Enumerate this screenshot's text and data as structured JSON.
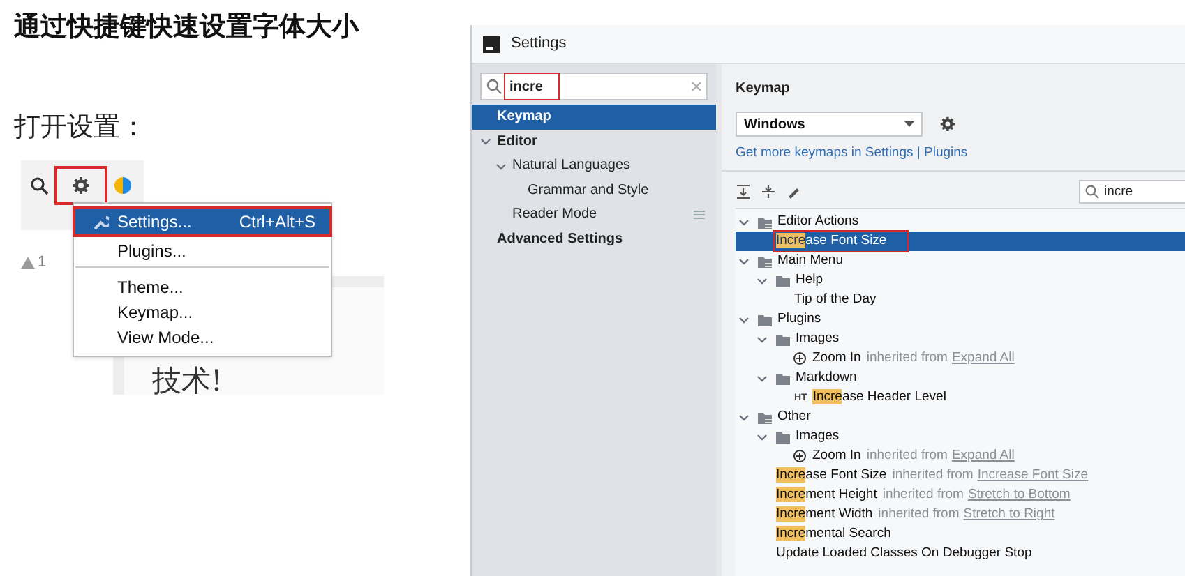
{
  "heading": "通过快捷键快速设置字体大小",
  "step": "打开设置：",
  "ide_snippet": {
    "warning_count": "1",
    "document_text": "技术!",
    "menu": [
      {
        "label": "Settings...",
        "shortcut": "Ctrl+Alt+S",
        "selected": true,
        "outlined": true,
        "divider_after": false
      },
      {
        "label": "Plugins...",
        "selected": false,
        "outlined": false,
        "divider_after": true
      },
      {
        "label": "Theme...",
        "selected": false,
        "outlined": false,
        "divider_after": false
      },
      {
        "label": "Keymap...",
        "selected": false,
        "outlined": false,
        "divider_after": false
      },
      {
        "label": "View Mode...",
        "selected": false,
        "outlined": false,
        "divider_after": false
      }
    ]
  },
  "settings": {
    "title": "Settings",
    "search": {
      "value": "incre",
      "outlined": true
    },
    "sidebar": [
      {
        "label": "Keymap",
        "bold": true,
        "selected": true
      },
      {
        "label": "Editor",
        "bold": true,
        "selected": false,
        "expanded": true,
        "children": [
          {
            "label": "Natural Languages",
            "bold": false,
            "selected": false,
            "expanded": true,
            "children": [
              {
                "label": "Grammar and Style",
                "bold": false,
                "selected": false
              }
            ]
          },
          {
            "label": "Reader Mode",
            "bold": false,
            "selected": false,
            "has_badge": true
          }
        ]
      },
      {
        "label": "Advanced Settings",
        "bold": true,
        "selected": false
      }
    ],
    "keymap": {
      "heading": "Keymap",
      "scheme": "Windows",
      "link": "Get more keymaps in Settings | Plugins",
      "filter": "incre",
      "tree": [
        {
          "kind": "group",
          "label": "Editor Actions",
          "expanded": true,
          "children": [
            {
              "kind": "action",
              "match": "Incre",
              "rest": "ase Font Size",
              "selected": true,
              "outlined": true
            }
          ]
        },
        {
          "kind": "group",
          "label": "Main Menu",
          "expanded": true,
          "children": [
            {
              "kind": "folder",
              "label": "Help",
              "expanded": true,
              "children": [
                {
                  "kind": "action",
                  "rest": "Tip of the Day",
                  "selected": false,
                  "outlined": false
                }
              ]
            }
          ]
        },
        {
          "kind": "folder",
          "label": "Plugins",
          "expanded": true,
          "children": [
            {
              "kind": "folder",
              "label": "Images",
              "expanded": true,
              "children": [
                {
                  "kind": "zoom_action",
                  "rest": "Zoom In",
                  "inherited": "inherited from",
                  "source": "Expand All",
                  "selected": false,
                  "outlined": false
                }
              ]
            },
            {
              "kind": "folder",
              "label": "Markdown",
              "expanded": true,
              "children": [
                {
                  "kind": "action",
                  "prefix": "HT",
                  "match": "Incre",
                  "rest": "ase Header Level",
                  "selected": false,
                  "outlined": false
                }
              ]
            }
          ]
        },
        {
          "kind": "group",
          "label": "Other",
          "expanded": true,
          "children": [
            {
              "kind": "folder",
              "label": "Images",
              "expanded": true,
              "children": [
                {
                  "kind": "zoom_action",
                  "rest": "Zoom In",
                  "inherited": "inherited from",
                  "source": "Expand All",
                  "selected": false,
                  "outlined": false
                }
              ]
            },
            {
              "kind": "action",
              "match": "Incre",
              "rest": "ase Font Size",
              "inherited": "inherited from",
              "source": "Increase Font Size",
              "selected": false,
              "outlined": false
            },
            {
              "kind": "action",
              "match": "Incre",
              "rest": "ment Height",
              "inherited": "inherited from",
              "source": "Stretch to Bottom",
              "selected": false,
              "outlined": false
            },
            {
              "kind": "action",
              "match": "Incre",
              "rest": "ment Width",
              "inherited": "inherited from",
              "source": "Stretch to Right",
              "selected": false,
              "outlined": false
            },
            {
              "kind": "action",
              "match": "Incre",
              "rest": "mental Search",
              "selected": false,
              "outlined": false
            },
            {
              "kind": "action",
              "rest": "Update Loaded Classes On Debugger Stop",
              "selected": false,
              "outlined": false
            }
          ]
        }
      ]
    }
  }
}
